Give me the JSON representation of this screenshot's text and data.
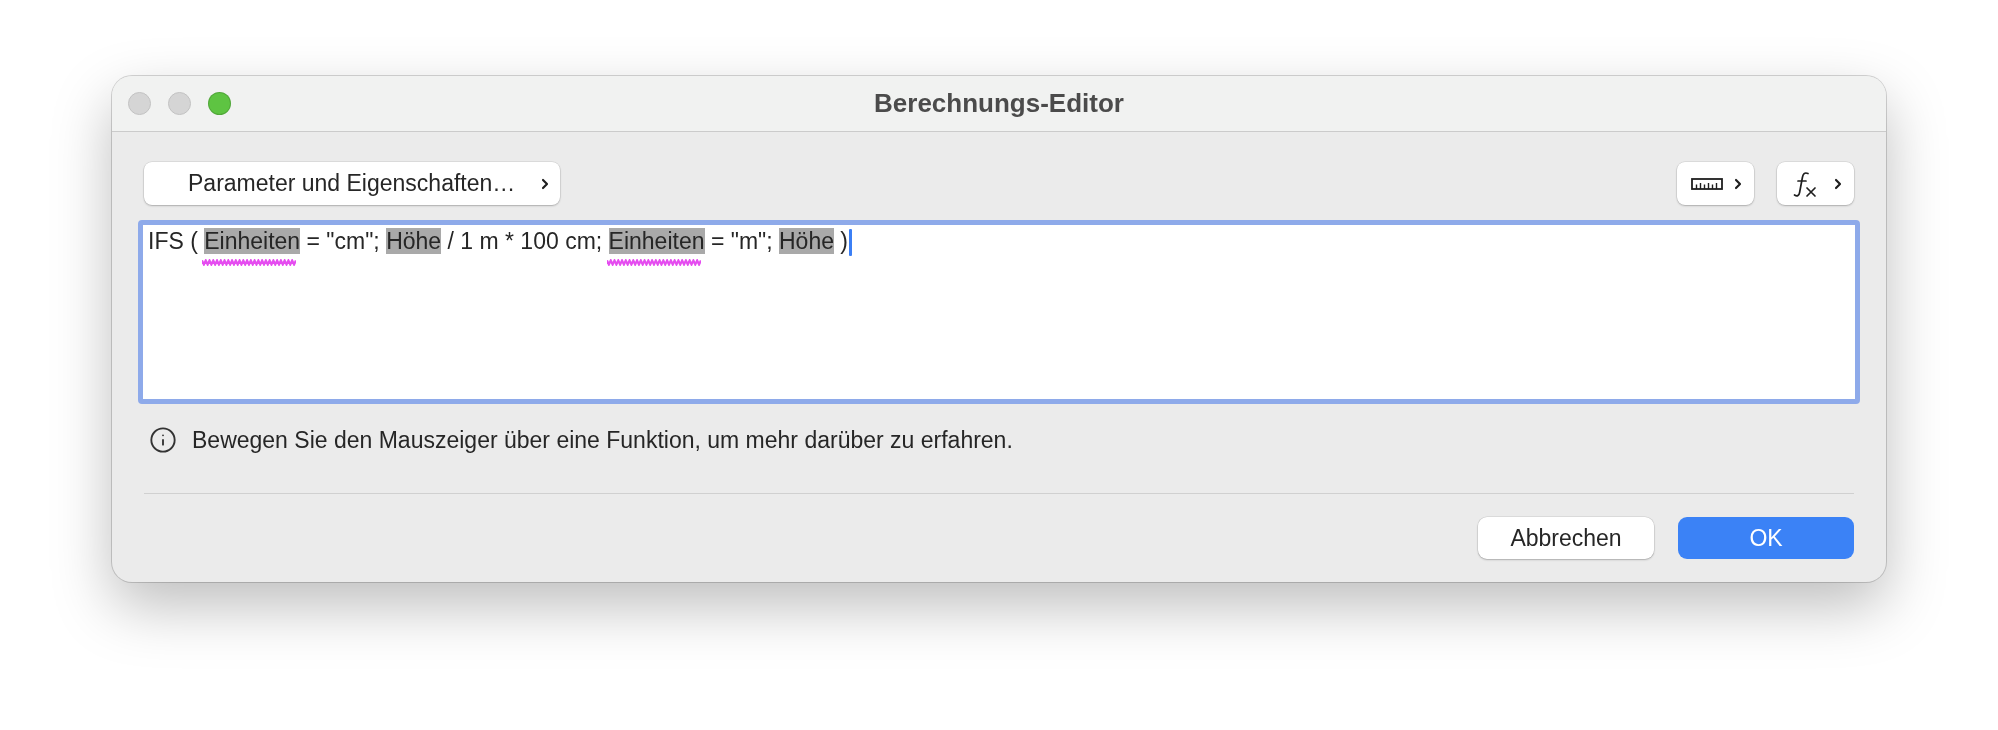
{
  "window": {
    "title": "Berechnungs-Editor",
    "traffic_lights": [
      {
        "kind": "close",
        "disabled": true
      },
      {
        "kind": "minimize",
        "disabled": true
      },
      {
        "kind": "zoom",
        "disabled": false
      }
    ]
  },
  "toolbar": {
    "parameter_button": {
      "label": "Parameter und Eigenschaften…"
    },
    "icon_buttons": [
      {
        "kind": "ruler"
      },
      {
        "kind": "function"
      }
    ]
  },
  "editor": {
    "focused": true,
    "tokens": [
      {
        "kind": "text",
        "text": "IFS ( ",
        "flagged": false
      },
      {
        "kind": "parameter",
        "text": "Einheiten",
        "flagged": true
      },
      {
        "kind": "text",
        "text": " = \"cm\"; ",
        "flagged": false
      },
      {
        "kind": "parameter",
        "text": "Höhe",
        "flagged": false
      },
      {
        "kind": "text",
        "text": " / 1 m * 100 cm; ",
        "flagged": false
      },
      {
        "kind": "parameter",
        "text": "Einheiten",
        "flagged": true
      },
      {
        "kind": "text",
        "text": " = \"m\"; ",
        "flagged": false
      },
      {
        "kind": "parameter",
        "text": "Höhe",
        "flagged": false
      },
      {
        "kind": "text",
        "text": " )",
        "flagged": false
      }
    ]
  },
  "hint": {
    "text": "Bewegen Sie den Mauszeiger über eine Funktion, um mehr darüber zu erfahren."
  },
  "buttons": [
    {
      "label": "Abbrechen",
      "default": false
    },
    {
      "label": "OK",
      "default": true
    }
  ]
}
